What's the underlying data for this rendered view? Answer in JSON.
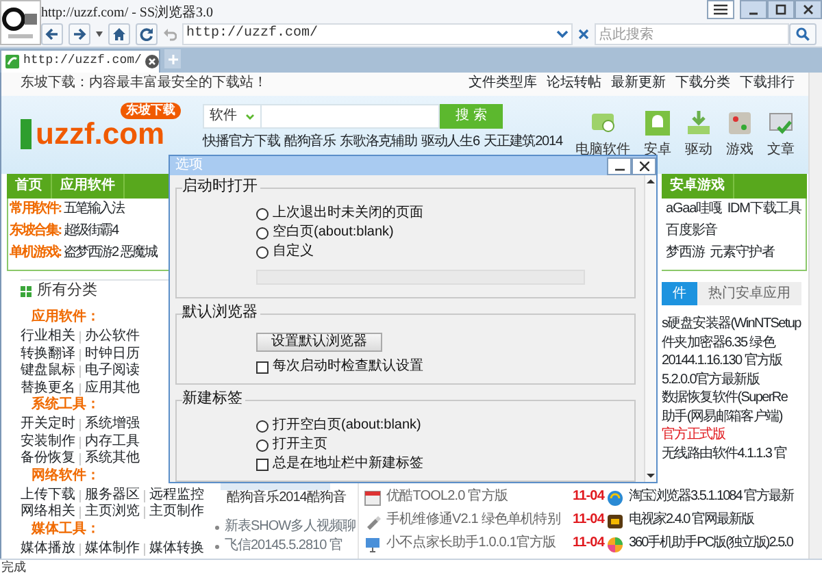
{
  "window": {
    "title": "http://uzzf.com/ - SS浏览器3.0"
  },
  "toolbar": {
    "address": "http://uzzf.com/",
    "search_placeholder": "点此搜索"
  },
  "tabs": [
    {
      "label": "http://uzzf.com/",
      "selected": true
    }
  ],
  "site": {
    "tagline": "东坡下载：内容最丰富最安全的下载站！",
    "top_links": [
      "文件类型库",
      "论坛转帖",
      "最新更新",
      "下载分类",
      "下载排行"
    ],
    "logo": {
      "text": "uzzf.com",
      "badge": "东坡下载"
    },
    "search": {
      "category": "软件",
      "button": "搜 索"
    },
    "hot_links": [
      "快播官方下载",
      "酷狗音乐",
      "东歌洛克辅助",
      "驱动人生6",
      "天正建筑2014"
    ],
    "shortcuts": [
      {
        "kind": "pc",
        "label": "电脑软件"
      },
      {
        "kind": "android",
        "label": "安卓"
      },
      {
        "kind": "driver",
        "label": "驱动"
      },
      {
        "kind": "game",
        "label": "游戏"
      },
      {
        "kind": "article",
        "label": "文章"
      }
    ],
    "nav_left": [
      "首页",
      "应用软件"
    ],
    "nav_right": [
      "安卓游戏"
    ],
    "featured": [
      {
        "label": "常用软件:",
        "items": [
          "五笔输入法"
        ]
      },
      {
        "label": "东坡合集:",
        "items": [
          "超级街霸4"
        ]
      },
      {
        "label": "单机游戏:",
        "items": [
          "盗梦西游2",
          "恶魔城"
        ]
      }
    ],
    "featured_right": [
      [
        "aGaa哇嘎",
        "IDM下载工具"
      ],
      [
        "百度影音"
      ],
      [
        "梦西游",
        "元素守护者"
      ]
    ],
    "categories_title": "所有分类",
    "categories": [
      {
        "kind": "heading",
        "text": "应用软件："
      },
      {
        "kind": "links",
        "items": [
          "行业相关",
          "办公软件"
        ]
      },
      {
        "kind": "links",
        "items": [
          "转换翻译",
          "时钟日历"
        ]
      },
      {
        "kind": "links",
        "items": [
          "键盘鼠标",
          "电子阅读"
        ]
      },
      {
        "kind": "links",
        "items": [
          "替换更名",
          "应用其他"
        ]
      },
      {
        "kind": "heading",
        "text": "系统工具："
      },
      {
        "kind": "links",
        "items": [
          "开关定时",
          "系统增强"
        ]
      },
      {
        "kind": "links",
        "items": [
          "安装制作",
          "内存工具"
        ]
      },
      {
        "kind": "links",
        "items": [
          "备份恢复",
          "系统其他"
        ]
      },
      {
        "kind": "heading",
        "text": "网络软件："
      },
      {
        "kind": "links",
        "items": [
          "上传下载",
          "服务器区",
          "远程监控"
        ]
      },
      {
        "kind": "links",
        "items": [
          "网络相关",
          "主页浏览",
          "主页制作"
        ]
      },
      {
        "kind": "heading",
        "text": "媒体工具："
      },
      {
        "kind": "links",
        "items": [
          "媒体播放",
          "媒体制作",
          "媒体转换"
        ]
      }
    ],
    "thumb_caption": "酷狗音乐2014酷狗音",
    "bullets": [
      "新表SHOW多人视频聊",
      "飞信20145.5.2810 官"
    ],
    "updates": [
      {
        "kind": "video",
        "title": "优酷TOOL2.0 官方版",
        "date": "11-04"
      },
      {
        "kind": "tool",
        "title": "手机维修通V2.1 绿色单机特别",
        "date": "11-04"
      },
      {
        "kind": "monitor",
        "title": "小不点家长助手1.0.0.1官方版",
        "date": "11-04"
      }
    ],
    "side_tabs": [
      {
        "label": "件",
        "selected": true
      },
      {
        "label": "热门安卓应用",
        "selected": false
      }
    ],
    "side_list": [
      {
        "text": "s硬盘安装器(WinNTSetup",
        "highlight": false
      },
      {
        "text": "件夹加密器6.35 绿色",
        "highlight": false
      },
      {
        "text": "20144.1.16.130 官方版",
        "highlight": false
      },
      {
        "text": "5.2.0.0官方最新版",
        "highlight": false
      },
      {
        "text": "数据恢复软件(SuperRe",
        "highlight": false
      },
      {
        "text": "助手(网易邮箱客户端)",
        "highlight": false
      },
      {
        "text": "官方正式版",
        "highlight": true
      },
      {
        "text": "无线路由软件4.1.1.3 官",
        "highlight": false
      }
    ],
    "side_apps": [
      {
        "kind": "browser",
        "title": "淘宝浏览器3.5.1.1084 官方最新"
      },
      {
        "kind": "tv",
        "title": "电视家2.4.0 官网最新版"
      },
      {
        "kind": "ball",
        "title": "360手机助手PC版(独立版)2.5.0"
      }
    ]
  },
  "dialog": {
    "title": "选项",
    "groups": [
      {
        "title": "启动时打开",
        "controls": [
          {
            "kind": "radio",
            "label": "上次退出时未关闭的页面",
            "checked": false
          },
          {
            "kind": "radio",
            "label": "空白页(about:blank)",
            "checked": false
          },
          {
            "kind": "radio",
            "label": "自定义",
            "checked": false
          },
          {
            "kind": "field",
            "disabled": true
          }
        ]
      },
      {
        "title": "默认浏览器",
        "controls": [
          {
            "kind": "button",
            "label": "设置默认浏览器"
          },
          {
            "kind": "checkbox",
            "label": "每次启动时检查默认设置",
            "checked": false
          }
        ]
      },
      {
        "title": "新建标签",
        "controls": [
          {
            "kind": "radio",
            "label": "打开空白页(about:blank)",
            "checked": false
          },
          {
            "kind": "radio",
            "label": "打开主页",
            "checked": false
          },
          {
            "kind": "checkbox",
            "label": "总是在地址栏中新建标签",
            "checked": false
          }
        ]
      }
    ]
  },
  "status_bar": {
    "text": "完成"
  }
}
